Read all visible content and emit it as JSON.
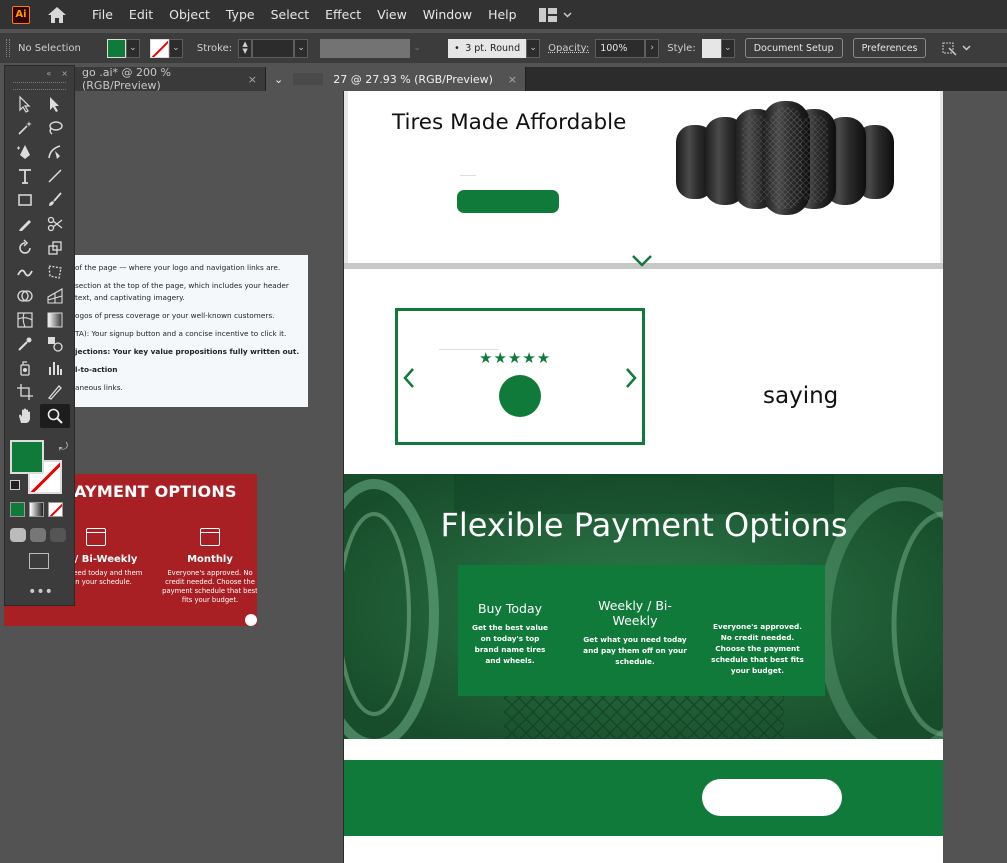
{
  "app": {
    "logo_text": "Ai",
    "menu": [
      "File",
      "Edit",
      "Object",
      "Type",
      "Select",
      "Effect",
      "View",
      "Window",
      "Help"
    ]
  },
  "control_bar": {
    "selection_label": "No Selection",
    "stroke_label": "Stroke:",
    "brush_label": "3 pt. Round",
    "opacity_label": "Opacity:",
    "opacity_value": "100%",
    "style_label": "Style:",
    "document_setup": "Document Setup",
    "preferences": "Preferences",
    "fill_color": "#0f7a3a"
  },
  "tabs": [
    {
      "label": "go .ai* @ 200 % (RGB/Preview)",
      "close": "×"
    },
    {
      "label": "27 @ 27.93 % (RGB/Preview)",
      "close": "×"
    }
  ],
  "notes": [
    {
      "text": "of the page — where your logo and navigation links are."
    },
    {
      "text": "section at the top of the page, which includes your header"
    },
    {
      "text": "text, and captivating imagery."
    },
    {
      "text": "ogos of press coverage or your well-known customers."
    },
    {
      "text": "TA): Your signup button and a concise incentive to click it."
    },
    {
      "text": "jections: Your key value propositions fully written out."
    },
    {
      "text": "l-to-action"
    },
    {
      "text": "aneous links."
    }
  ],
  "red_board": {
    "title": "AYMENT OPTIONS",
    "col1_title": "kly / Bi-Weekly",
    "col1_text": "t you need today and them off on your schedule.",
    "col2_title": "Monthly",
    "col2_text": "Everyone's approved. No credit needed. Choose the payment schedule that best fits your budget."
  },
  "artboard": {
    "hero_title": "Tires Made Affordable",
    "stars": "★★★★★",
    "saying": "saying",
    "payment_title": "Flexible Payment Options",
    "col1_title": "Buy Today",
    "col1_text": "Get the best value on today's top brand name tires and wheels.",
    "col2_title": "Weekly / Bi-Weekly",
    "col2_text": "Get what you need today and pay them off on your schedule.",
    "col3_text": "Everyone's approved. No credit needed. Choose the payment schedule that best fits your budget.",
    "brand_green": "#0f7a3a"
  }
}
